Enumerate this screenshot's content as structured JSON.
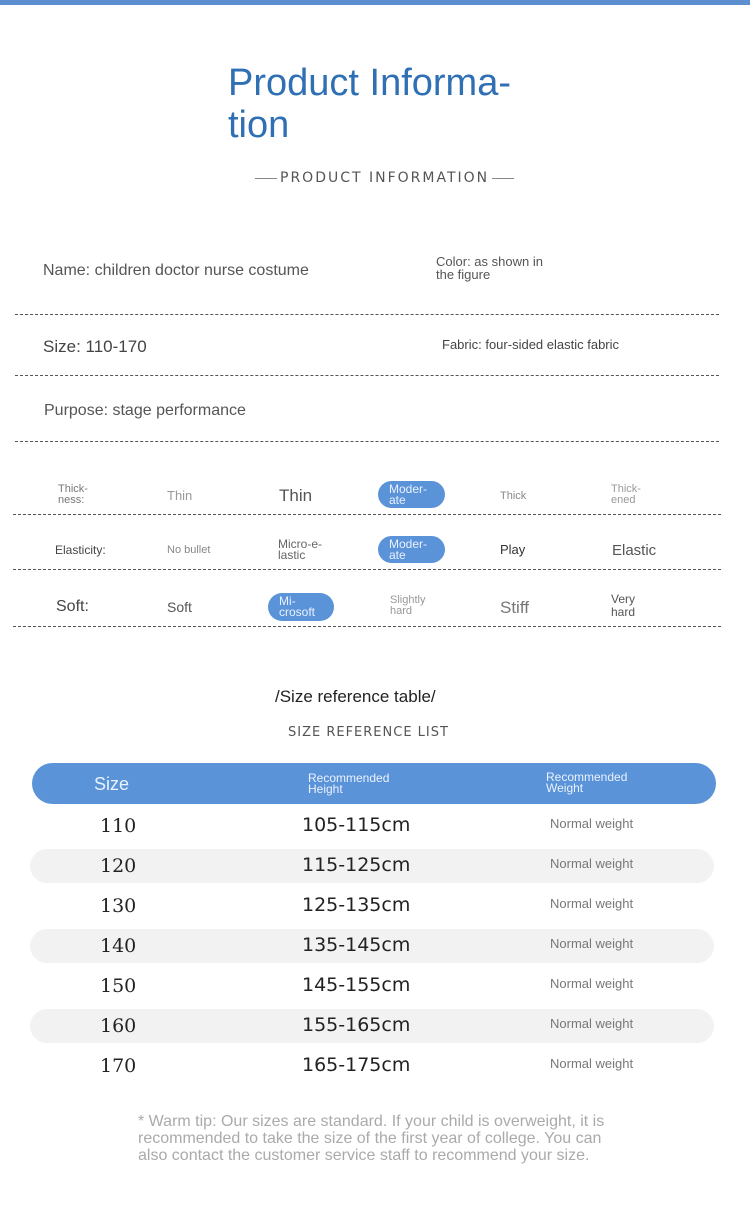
{
  "header": {
    "title_line1": "Product Informa-",
    "title_line2": "tion",
    "subtitle": "PRODUCT INFORMATION"
  },
  "info": {
    "name": "Name: children doctor nurse costume",
    "color_line1": "Color: as shown in",
    "color_line2": "the figure",
    "size": "Size: 110-170",
    "fabric": "Fabric: four-sided elastic fabric",
    "purpose": "Purpose: stage performance"
  },
  "attributes": {
    "thickness": {
      "label_line1": "Thick-",
      "label_line2": "ness:",
      "opt1": "Thin",
      "opt2": "Thin",
      "opt3_line1": "Moder-",
      "opt3_line2": "ate",
      "opt4": "Thick",
      "opt5_line1": "Thick-",
      "opt5_line2": "ened",
      "selected": "Moderate"
    },
    "elasticity": {
      "label": "Elasticity:",
      "opt1": "No bullet",
      "opt2_line1": "Micro-e-",
      "opt2_line2": "lastic",
      "opt3_line1": "Moder-",
      "opt3_line2": "ate",
      "opt4": "Play",
      "opt5": "Elastic",
      "selected": "Moderate"
    },
    "softness": {
      "label": "Soft:",
      "opt1": "Soft",
      "opt2_line1": "Mi-",
      "opt2_line2": "crosoft",
      "opt3_line1": "Slightly",
      "opt3_line2": "hard",
      "opt4": "Stiff",
      "opt5_line1": "Very",
      "opt5_line2": "hard",
      "selected": "Microsoft"
    }
  },
  "size_table": {
    "title": "/Size reference table/",
    "subtitle": "SIZE REFERENCE LIST",
    "col_size": "Size",
    "col_height_line1": "Recommended",
    "col_height_line2": "Height",
    "col_weight_line1": "Recommended",
    "col_weight_line2": "Weight",
    "rows": [
      {
        "size": "110",
        "height": "105-115cm",
        "weight": "Normal weight"
      },
      {
        "size": "120",
        "height": "115-125cm",
        "weight": "Normal weight"
      },
      {
        "size": "130",
        "height": "125-135cm",
        "weight": "Normal weight"
      },
      {
        "size": "140",
        "height": "135-145cm",
        "weight": "Normal weight"
      },
      {
        "size": "150",
        "height": "145-155cm",
        "weight": "Normal weight"
      },
      {
        "size": "160",
        "height": "155-165cm",
        "weight": "Normal weight"
      },
      {
        "size": "170",
        "height": "165-175cm",
        "weight": "Normal weight"
      }
    ]
  },
  "tip": "* Warm tip: Our sizes are standard. If your child is overweight, it is recommended to take the size of the first year of college. You can also contact the customer service staff to recommend your size.",
  "colors": {
    "accent": "#5b93d8",
    "title": "#2f6fb3"
  }
}
